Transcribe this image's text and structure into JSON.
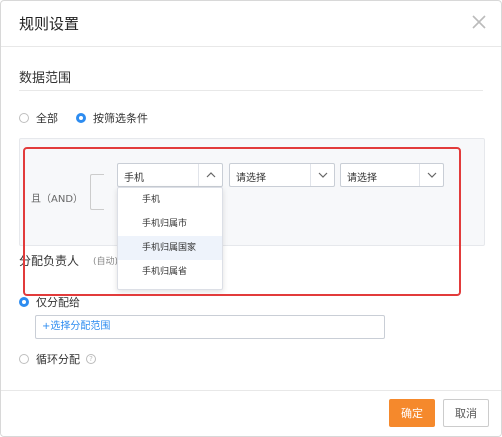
{
  "dialog": {
    "title": "规则设置",
    "close_icon": "close-icon"
  },
  "data_range": {
    "title": "数据范围",
    "options": [
      {
        "label": "全部",
        "checked": false
      },
      {
        "label": "按筛选条件",
        "checked": true
      }
    ]
  },
  "conditions": {
    "and_label": "且（AND）",
    "selects": [
      {
        "value": "手机",
        "open": true
      },
      {
        "value": "请选择",
        "open": false
      },
      {
        "value": "请选择",
        "open": false
      }
    ],
    "dropdown_options": [
      {
        "label": "手机",
        "hovered": false
      },
      {
        "label": "手机归属市",
        "hovered": false
      },
      {
        "label": "手机归属国家",
        "hovered": true
      },
      {
        "label": "手机归属省",
        "hovered": false
      }
    ]
  },
  "assignment": {
    "title": "分配负责人",
    "note": "(自动)",
    "options": [
      {
        "label": "仅分配给",
        "checked": true
      },
      {
        "label": "循环分配",
        "checked": false
      }
    ],
    "range_link": "+选择分配范围",
    "help_icon": "question-circle-icon"
  },
  "footer": {
    "confirm_label": "确定",
    "cancel_label": "取消"
  },
  "colors": {
    "accent": "#2d8cf0",
    "primary_button": "#f5892c",
    "highlight": "#e23b3b"
  }
}
